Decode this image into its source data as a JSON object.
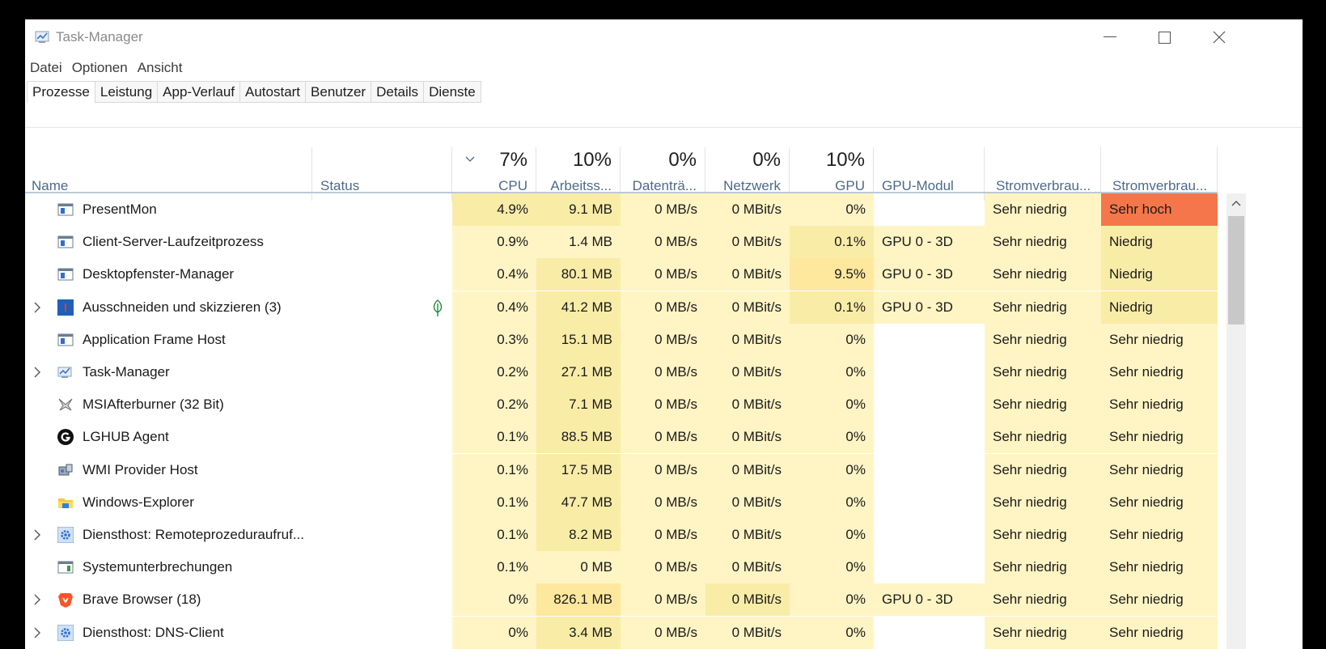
{
  "window": {
    "title": "Task-Manager"
  },
  "menu": [
    "Datei",
    "Optionen",
    "Ansicht"
  ],
  "tabs": [
    {
      "label": "Prozesse",
      "active": true
    },
    {
      "label": "Leistung"
    },
    {
      "label": "App-Verlauf"
    },
    {
      "label": "Autostart"
    },
    {
      "label": "Benutzer"
    },
    {
      "label": "Details"
    },
    {
      "label": "Dienste"
    }
  ],
  "columns": {
    "name": {
      "label": "Name"
    },
    "status": {
      "label": "Status"
    },
    "cpu": {
      "label": "CPU",
      "pct": "7%"
    },
    "mem": {
      "label": "Arbeitss...",
      "pct": "10%"
    },
    "disk": {
      "label": "Datenträ...",
      "pct": "0%"
    },
    "net": {
      "label": "Netzwerk",
      "pct": "0%"
    },
    "gpu": {
      "label": "GPU",
      "pct": "10%"
    },
    "gpu_engine": {
      "label": "GPU-Modul"
    },
    "power": {
      "label": "Stromverbrau..."
    },
    "power_trend": {
      "label": "Stromverbrau..."
    }
  },
  "rows": [
    {
      "name": "PresentMon",
      "icon": "window-icon",
      "expandable": false,
      "cpu": "4.9%",
      "mem": "9.1 MB",
      "disk": "0 MB/s",
      "net": "0 MBit/s",
      "gpu": "0%",
      "gpu_engine": "",
      "power": "Sehr niedrig",
      "power_trend": "Sehr hoch"
    },
    {
      "name": "Client-Server-Laufzeitprozess",
      "icon": "window-icon",
      "expandable": false,
      "cpu": "0.9%",
      "mem": "1.4 MB",
      "disk": "0 MB/s",
      "net": "0 MBit/s",
      "gpu": "0.1%",
      "gpu_engine": "GPU 0 - 3D",
      "power": "Sehr niedrig",
      "power_trend": "Niedrig"
    },
    {
      "name": "Desktopfenster-Manager",
      "icon": "window-icon",
      "expandable": false,
      "cpu": "0.4%",
      "mem": "80.1 MB",
      "disk": "0 MB/s",
      "net": "0 MBit/s",
      "gpu": "9.5%",
      "gpu_engine": "GPU 0 - 3D",
      "power": "Sehr niedrig",
      "power_trend": "Niedrig"
    },
    {
      "name": "Ausschneiden und skizzieren (3)",
      "icon": "snip-sketch-icon",
      "expandable": true,
      "suspended": true,
      "cpu": "0.4%",
      "mem": "41.2 MB",
      "disk": "0 MB/s",
      "net": "0 MBit/s",
      "gpu": "0.1%",
      "gpu_engine": "GPU 0 - 3D",
      "power": "Sehr niedrig",
      "power_trend": "Niedrig"
    },
    {
      "name": "Application Frame Host",
      "icon": "window-icon",
      "expandable": false,
      "cpu": "0.3%",
      "mem": "15.1 MB",
      "disk": "0 MB/s",
      "net": "0 MBit/s",
      "gpu": "0%",
      "gpu_engine": "",
      "power": "Sehr niedrig",
      "power_trend": "Sehr niedrig"
    },
    {
      "name": "Task-Manager",
      "icon": "task-manager-icon",
      "expandable": true,
      "cpu": "0.2%",
      "mem": "27.1 MB",
      "disk": "0 MB/s",
      "net": "0 MBit/s",
      "gpu": "0%",
      "gpu_engine": "",
      "power": "Sehr niedrig",
      "power_trend": "Sehr niedrig"
    },
    {
      "name": "MSIAfterburner (32 Bit)",
      "icon": "afterburner-icon",
      "expandable": false,
      "cpu": "0.2%",
      "mem": "7.1 MB",
      "disk": "0 MB/s",
      "net": "0 MBit/s",
      "gpu": "0%",
      "gpu_engine": "",
      "power": "Sehr niedrig",
      "power_trend": "Sehr niedrig"
    },
    {
      "name": "LGHUB Agent",
      "icon": "logitech-g-icon",
      "expandable": false,
      "cpu": "0.1%",
      "mem": "88.5 MB",
      "disk": "0 MB/s",
      "net": "0 MBit/s",
      "gpu": "0%",
      "gpu_engine": "",
      "power": "Sehr niedrig",
      "power_trend": "Sehr niedrig"
    },
    {
      "name": "WMI Provider Host",
      "icon": "wmi-icon",
      "expandable": false,
      "cpu": "0.1%",
      "mem": "17.5 MB",
      "disk": "0 MB/s",
      "net": "0 MBit/s",
      "gpu": "0%",
      "gpu_engine": "",
      "power": "Sehr niedrig",
      "power_trend": "Sehr niedrig"
    },
    {
      "name": "Windows-Explorer",
      "icon": "folder-icon",
      "expandable": false,
      "cpu": "0.1%",
      "mem": "47.7 MB",
      "disk": "0 MB/s",
      "net": "0 MBit/s",
      "gpu": "0%",
      "gpu_engine": "",
      "power": "Sehr niedrig",
      "power_trend": "Sehr niedrig"
    },
    {
      "name": "Diensthost: Remoteprozeduraufruf...",
      "icon": "service-gear-icon",
      "expandable": true,
      "cpu": "0.1%",
      "mem": "8.2 MB",
      "disk": "0 MB/s",
      "net": "0 MBit/s",
      "gpu": "0%",
      "gpu_engine": "",
      "power": "Sehr niedrig",
      "power_trend": "Sehr niedrig"
    },
    {
      "name": "Systemunterbrechungen",
      "icon": "system-window-icon",
      "expandable": false,
      "cpu": "0.1%",
      "mem": "0 MB",
      "disk": "0 MB/s",
      "net": "0 MBit/s",
      "gpu": "0%",
      "gpu_engine": "",
      "power": "Sehr niedrig",
      "power_trend": "Sehr niedrig"
    },
    {
      "name": "Brave Browser (18)",
      "icon": "brave-lion-icon",
      "expandable": true,
      "cpu": "0%",
      "mem": "826.1 MB",
      "disk": "0 MB/s",
      "net": "0 MBit/s",
      "gpu": "0%",
      "gpu_engine": "GPU 0 - 3D",
      "power": "Sehr niedrig",
      "power_trend": "Sehr niedrig"
    },
    {
      "name": "Diensthost: DNS-Client",
      "icon": "service-gear-icon",
      "expandable": true,
      "cpu": "0%",
      "mem": "3.4 MB",
      "disk": "0 MB/s",
      "net": "0 MBit/s",
      "gpu": "0%",
      "gpu_engine": "",
      "power": "Sehr niedrig",
      "power_trend": "Sehr niedrig"
    }
  ],
  "colors": {
    "heat_low": "#fff4c4",
    "heat_mid": "#f9eca7",
    "heat_high": "#fde89d",
    "heat_very_high": "#f4764a",
    "header_label": "#4d6a8a"
  }
}
